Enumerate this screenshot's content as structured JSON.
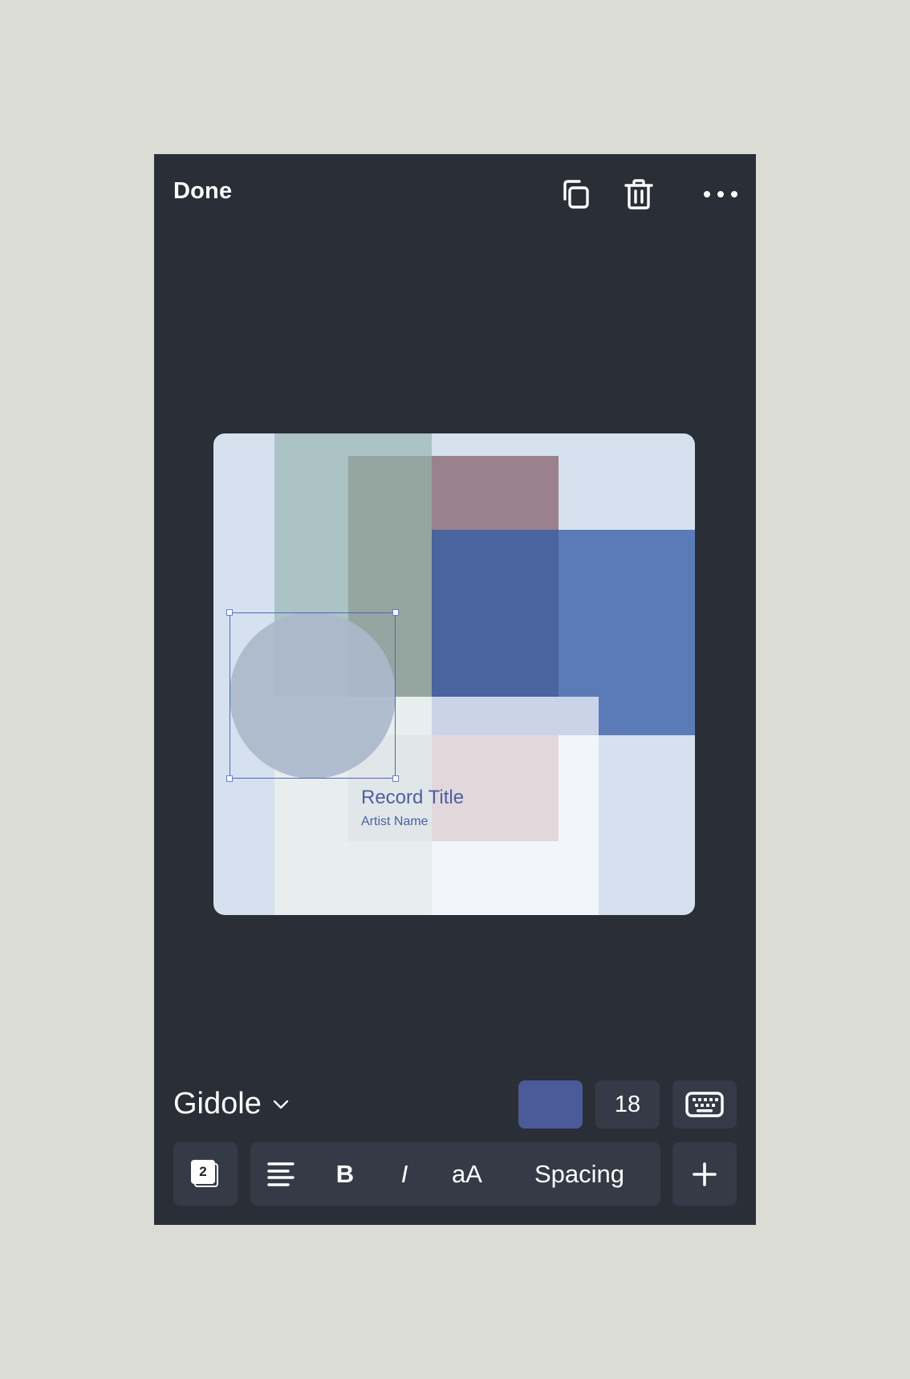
{
  "topbar": {
    "done_label": "Done",
    "icons": [
      "duplicate-icon",
      "trash-icon",
      "more-icon"
    ]
  },
  "canvas": {
    "record_title": "Record Title",
    "artist_name": "Artist Name"
  },
  "format": {
    "font_name": "Gidole",
    "text_color": "#4b5a99",
    "font_size": "18"
  },
  "toolbar": {
    "layer_count": "2",
    "bold_label": "B",
    "italic_label": "I",
    "case_label": "aA",
    "spacing_label": "Spacing"
  },
  "colors": {
    "background": "#292e37",
    "chip": "#353b46",
    "accent": "#4b5a99"
  }
}
